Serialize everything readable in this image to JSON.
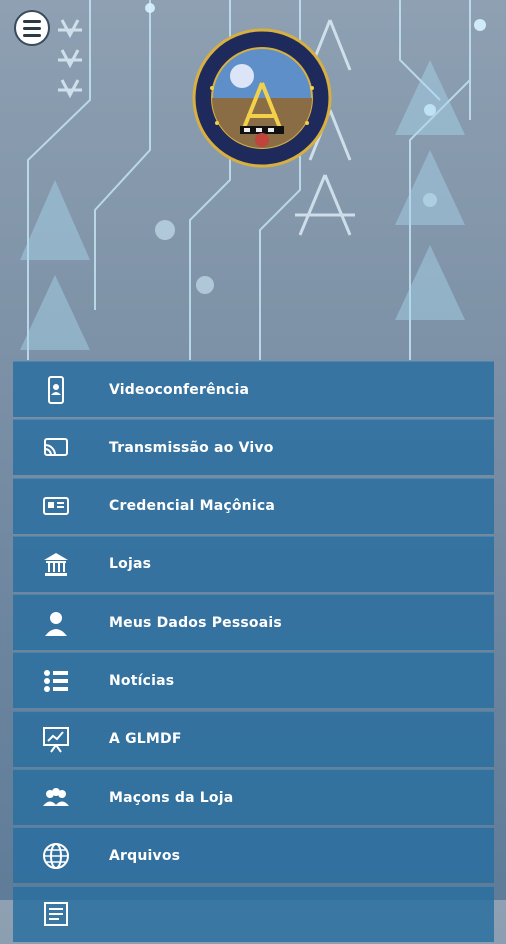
{
  "colors": {
    "menu_item_bg": "#2a6ea0",
    "label_text": "#ffffff",
    "background": "#7f93a8"
  },
  "header": {
    "menu_icon": "hamburger-menu-icon",
    "logo_icon": "glmdf-seal-logo"
  },
  "menu": {
    "items": [
      {
        "label": "Videoconferência",
        "icon": "phone-video-icon"
      },
      {
        "label": "Transmissão ao Vivo",
        "icon": "cast-icon"
      },
      {
        "label": "Credencial Maçônica",
        "icon": "id-card-icon"
      },
      {
        "label": "Lojas",
        "icon": "temple-icon"
      },
      {
        "label": "Meus Dados Pessoais",
        "icon": "user-icon"
      },
      {
        "label": "Notícias",
        "icon": "list-icon"
      },
      {
        "label": "A GLMDF",
        "icon": "presentation-icon"
      },
      {
        "label": "Maçons da Loja",
        "icon": "group-icon"
      },
      {
        "label": "Arquivos",
        "icon": "globe-icon"
      },
      {
        "label": "",
        "icon": "document-icon"
      }
    ]
  }
}
